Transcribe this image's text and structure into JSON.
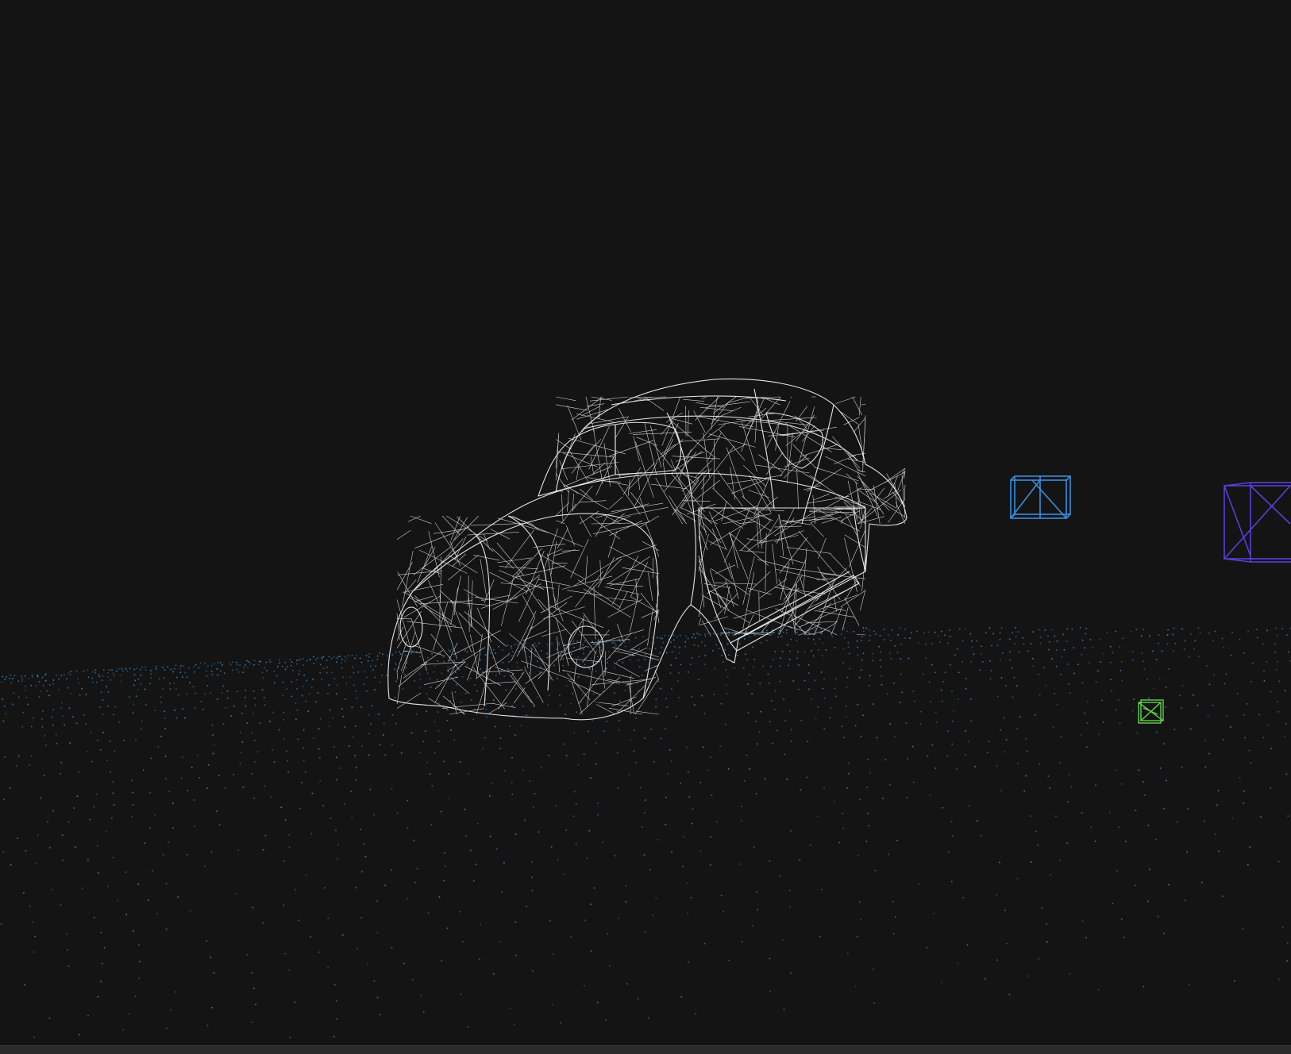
{
  "scene": {
    "background": "#141414",
    "colors": {
      "car_wire": "#f0f0f0",
      "ground_points": "#3d8fd0",
      "blue_box": "#3a8ee0",
      "purple_box": "#5a3fd8",
      "green_box": "#63d24a"
    },
    "objects": [
      {
        "name": "car-wireframe-model",
        "kind": "wireframe-mesh"
      },
      {
        "name": "blue-box-wireframe",
        "kind": "wireframe-cube"
      },
      {
        "name": "purple-box-wireframe",
        "kind": "wireframe-cube"
      },
      {
        "name": "green-box-wireframe",
        "kind": "wireframe-cube"
      },
      {
        "name": "ground-point-grid",
        "kind": "point-cloud"
      }
    ]
  }
}
